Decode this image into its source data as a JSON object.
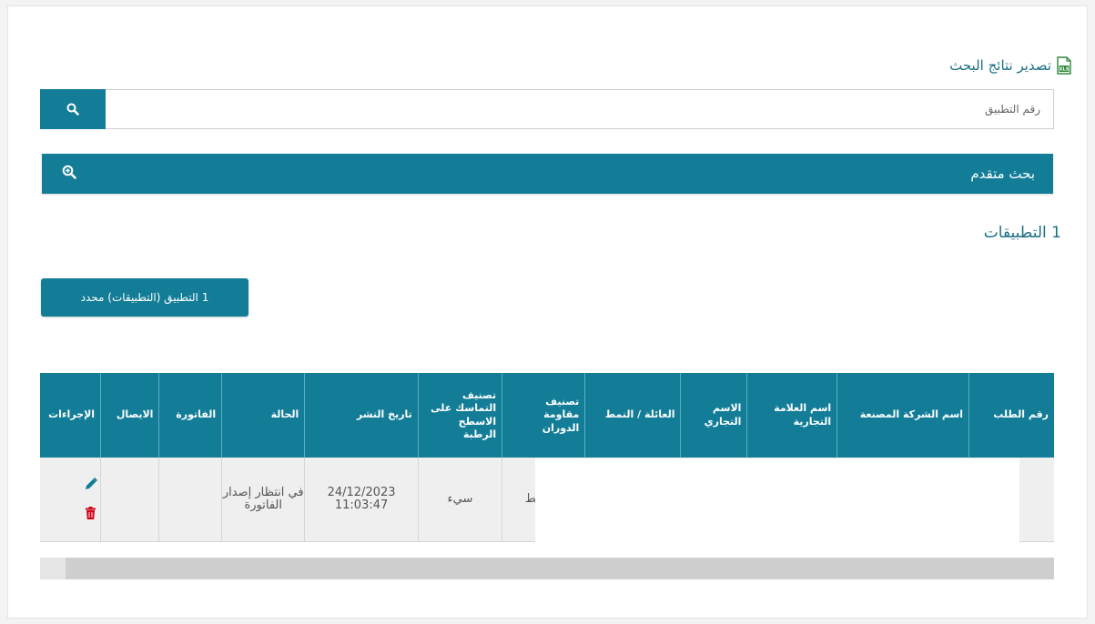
{
  "export": {
    "label": "تصدير نتائج البحث",
    "icon": "excel-xls-icon"
  },
  "search": {
    "placeholder": "رقم التطبيق",
    "button_icon": "search-icon"
  },
  "advanced_search": {
    "label": "بحث متقدم",
    "icon": "zoom-in-icon"
  },
  "results_count": "1 التطبيقات",
  "selected_button": "1 التطبيق (التطبيقات) محدد",
  "table": {
    "headers": {
      "request_number": "رقم الطلب",
      "manufacturer": "اسم الشركة المصنعة",
      "brand": "اسم العلامة التجارية",
      "trade_name": "الاسم التجاري",
      "family_pattern": "العائلة / النمط",
      "rolling_resistance": "تصنيف مقاومة الدوران",
      "wet_grip": "تصنيف التماسك على الاسطح الرطبة",
      "publish_date": "تاريخ النشر",
      "status": "الحالة",
      "invoice": "الفاتورة",
      "receipt": "الايصال",
      "actions": "الإجراءات"
    },
    "row": {
      "rolling_resistance": "متوسط",
      "wet_grip": "سيء",
      "publish_date": "24/12/2023 11:03:47",
      "status": "في انتظار إصدار الفاتورة"
    }
  },
  "colors": {
    "primary": "#137d98",
    "link": "#1a6f85",
    "delete": "#d0021b"
  }
}
